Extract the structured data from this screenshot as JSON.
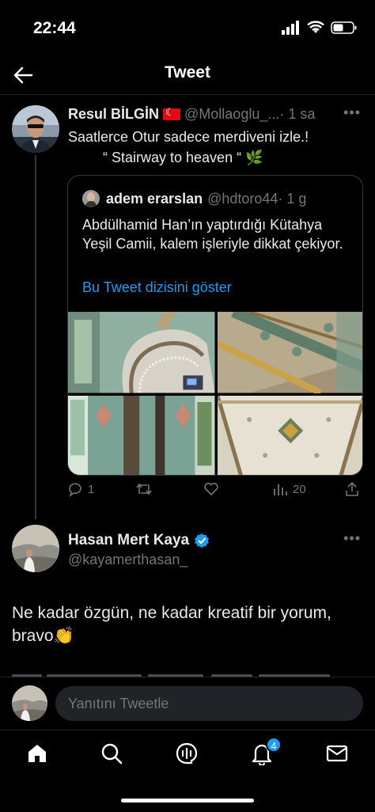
{
  "status_bar": {
    "time": "22:44"
  },
  "header": {
    "title": "Tweet"
  },
  "tweet": {
    "author_name": "Resul BİLGİN",
    "handle": "@Mollaoglu_...",
    "time": "· 1 sa",
    "text_line1": "Saatlerce Otur sadece merdiveni izle.!",
    "text_line2": "“ Stairway to heaven “",
    "plant_emoji": "🌿",
    "quote": {
      "author_name": "adem erarslan",
      "handle": "@hdtoro44",
      "time": "· 1 g",
      "text": "Abdülhamid Han’ın yaptırdığı Kütahya Yeşil Camii, kalem işleriyle dikkat çekiyor.",
      "link": "Bu Tweet dizisini göster"
    },
    "stats": {
      "replies": "1",
      "views": "20"
    }
  },
  "reply": {
    "author_name": "Hasan Mert Kaya",
    "handle": "@kayamerthasan_",
    "text": "Ne kadar özgün, ne kadar kreatif bir yorum, bravo",
    "clap_emoji": "👏"
  },
  "composer": {
    "placeholder": "Yanıtını Tweetle"
  },
  "tab_bar": {
    "notifications_badge": "4"
  },
  "colors": {
    "accent": "#1d9bf0",
    "background": "#000000",
    "muted": "#71767b"
  }
}
